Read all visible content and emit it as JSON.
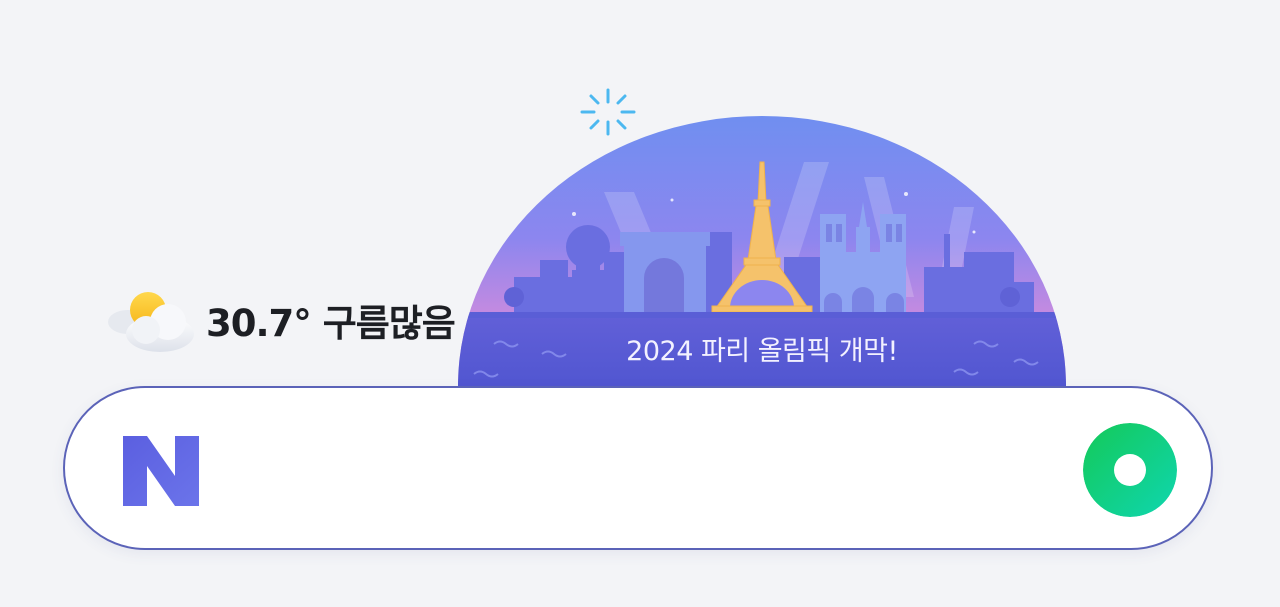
{
  "weather": {
    "temperature": "30.7°",
    "condition": "구름많음",
    "icon": "partly-cloudy-icon"
  },
  "doodle": {
    "caption": "2024 파리 올림픽 개막!"
  },
  "search": {
    "logo_letter": "N",
    "query": "",
    "logo_color": "#5b5fe0",
    "button_color": "#19ce60",
    "button_icon": "green-ring-search-icon"
  }
}
